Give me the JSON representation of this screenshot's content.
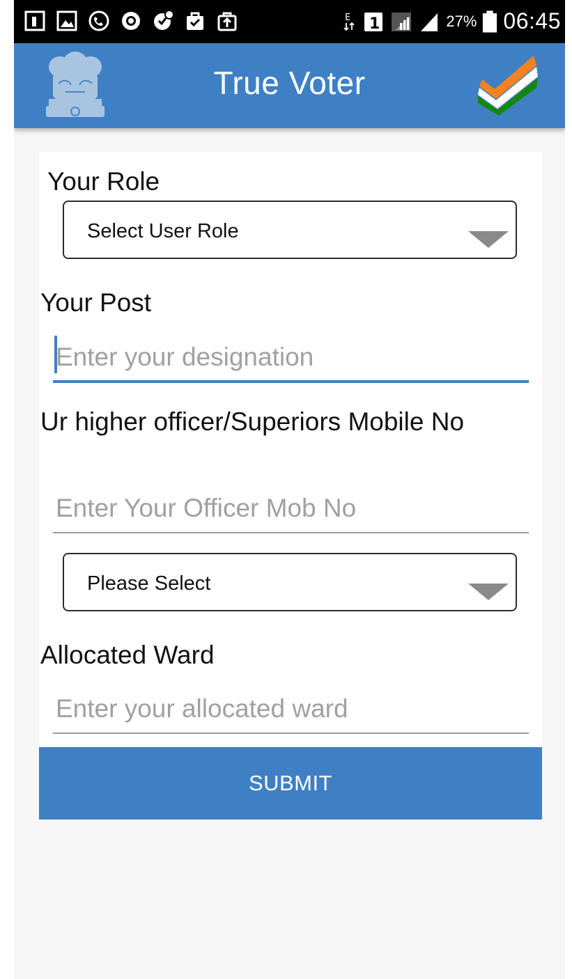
{
  "status_bar": {
    "icons": [
      "sim-icon",
      "gallery-icon",
      "call-icon",
      "record-icon",
      "whatsapp-icon",
      "bag-check-icon",
      "bag-upload-icon"
    ],
    "network_type": "E",
    "sim_slot": "1",
    "battery_percent": "27%",
    "time": "06:45"
  },
  "app_bar": {
    "title": "True Voter",
    "background": "#3f80c5"
  },
  "form": {
    "role": {
      "label": "Your Role",
      "selected": "Select User Role"
    },
    "post": {
      "label": "Your Post",
      "placeholder": "Enter your designation"
    },
    "officer_mobile": {
      "label": "Ur higher officer/Superiors Mobile No",
      "placeholder": "Enter Your Officer Mob No"
    },
    "officer_select": {
      "selected": "Please Select"
    },
    "ward": {
      "label": "Allocated Ward",
      "placeholder": "Enter your allocated ward"
    },
    "submit_label": "SUBMIT"
  },
  "colors": {
    "accent": "#3f80c5",
    "tick_saffron": "#f58220",
    "tick_green": "#138808"
  }
}
